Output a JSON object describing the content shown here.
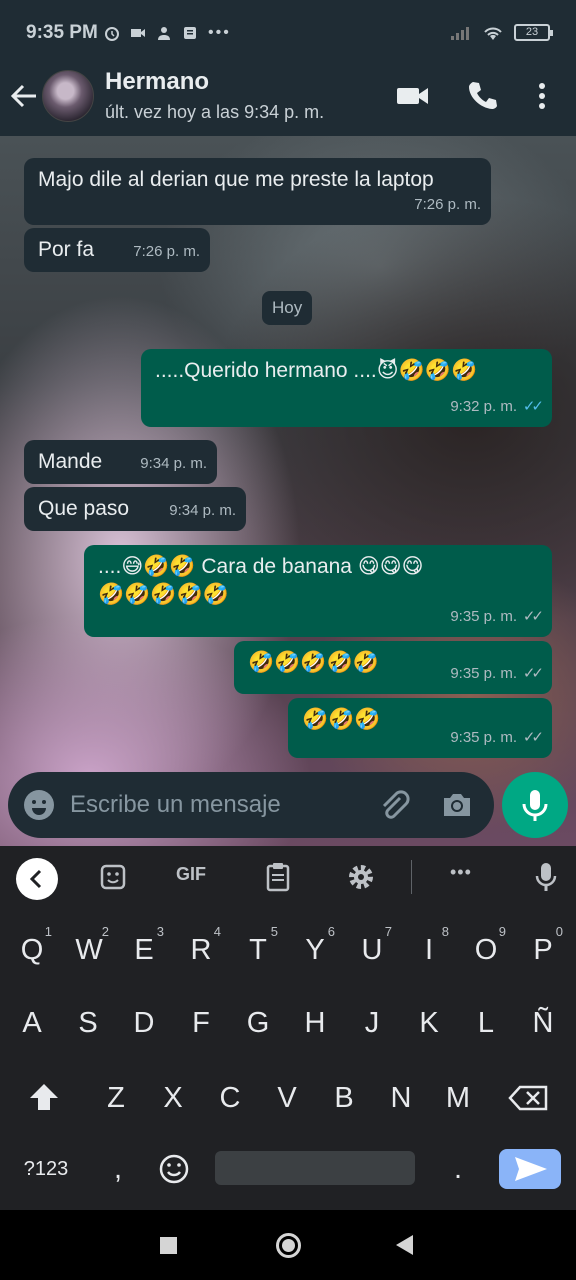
{
  "status_bar": {
    "time": "9:35 PM",
    "battery": "23"
  },
  "header": {
    "contact_name": "Hermano",
    "contact_status": "últ. vez hoy a las 9:34 p. m."
  },
  "chat": {
    "day_separator": "Hoy",
    "messages": [
      {
        "dir": "in",
        "text": "Majo dile al derian que me preste la laptop",
        "time": "7:26 p. m."
      },
      {
        "dir": "in",
        "text": "Por fa",
        "time": "7:26 p. m."
      },
      {
        "dir": "out",
        "text": ".....Querido hermano ....😈🤣🤣🤣",
        "time": "9:32 p. m.",
        "ticks": "read"
      },
      {
        "dir": "in",
        "text": "Mande",
        "time": "9:34 p. m."
      },
      {
        "dir": "in",
        "text": "Que paso",
        "time": "9:34 p. m."
      },
      {
        "dir": "out",
        "text_line1": "....😅🤣🤣 Cara de banana 😋😋😋",
        "text_line2": "🤣🤣🤣🤣🤣",
        "time": "9:35 p. m.",
        "ticks": "delivered"
      },
      {
        "dir": "out",
        "text": "🤣🤣🤣🤣🤣",
        "time": "9:35 p. m.",
        "ticks": "delivered"
      },
      {
        "dir": "out",
        "text": "🤣🤣🤣",
        "time": "9:35 p. m.",
        "ticks": "delivered"
      }
    ]
  },
  "composer": {
    "placeholder": "Escribe un mensaje"
  },
  "keyboard": {
    "toolbar": {
      "gif_label": "GIF"
    },
    "row1": [
      {
        "k": "Q",
        "n": "1"
      },
      {
        "k": "W",
        "n": "2"
      },
      {
        "k": "E",
        "n": "3"
      },
      {
        "k": "R",
        "n": "4"
      },
      {
        "k": "T",
        "n": "5"
      },
      {
        "k": "Y",
        "n": "6"
      },
      {
        "k": "U",
        "n": "7"
      },
      {
        "k": "I",
        "n": "8"
      },
      {
        "k": "O",
        "n": "9"
      },
      {
        "k": "P",
        "n": "0"
      }
    ],
    "row2": [
      "A",
      "S",
      "D",
      "F",
      "G",
      "H",
      "J",
      "K",
      "L",
      "Ñ"
    ],
    "row3": [
      "Z",
      "X",
      "C",
      "V",
      "B",
      "N",
      "M"
    ],
    "symbols_key": "?123",
    "comma_key": ",",
    "period_key": "."
  }
}
